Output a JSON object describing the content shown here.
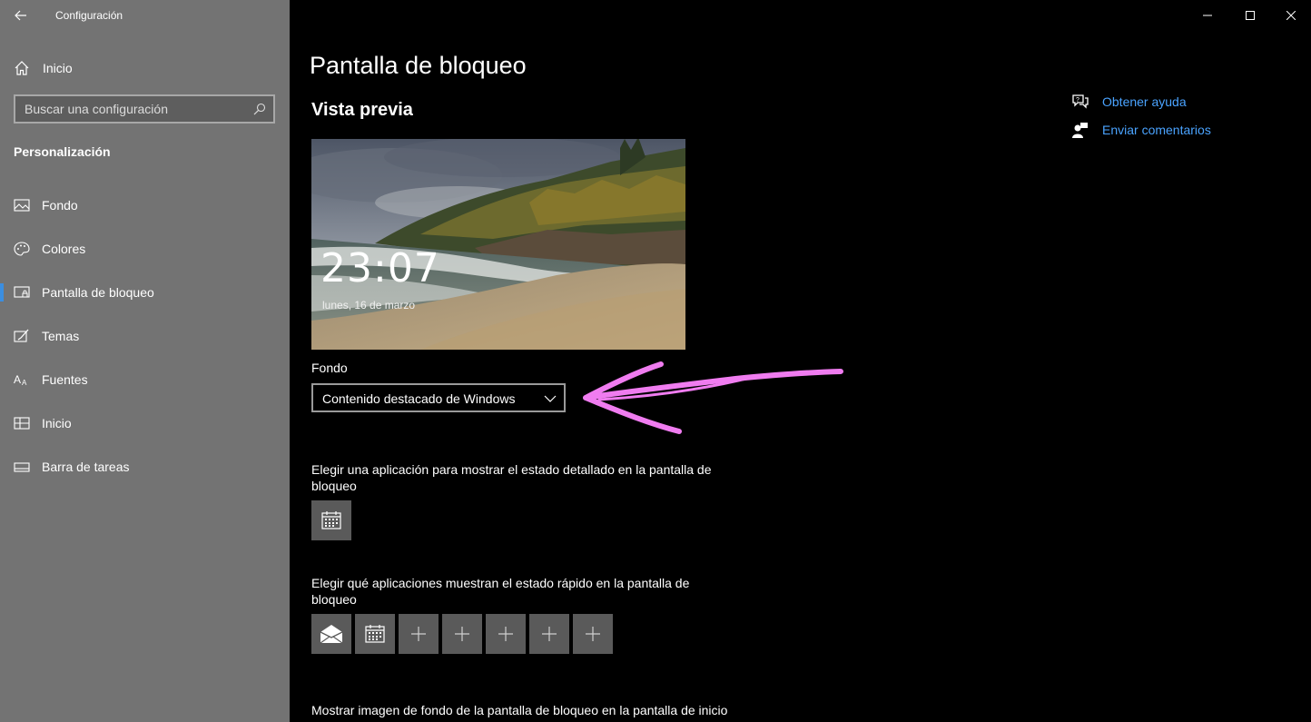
{
  "window": {
    "title": "Configuración",
    "controls": [
      "minimize-icon",
      "maximize-icon",
      "close-icon"
    ]
  },
  "sidebar": {
    "home_label": "Inicio",
    "search_placeholder": "Buscar una configuración",
    "section_title": "Personalización",
    "items": [
      {
        "label": "Fondo",
        "icon": "picture-icon"
      },
      {
        "label": "Colores",
        "icon": "palette-icon"
      },
      {
        "label": "Pantalla de bloqueo",
        "icon": "lock-screen-icon",
        "active": true
      },
      {
        "label": "Temas",
        "icon": "brush-icon"
      },
      {
        "label": "Fuentes",
        "icon": "font-icon"
      },
      {
        "label": "Inicio",
        "icon": "start-icon"
      },
      {
        "label": "Barra de tareas",
        "icon": "taskbar-icon"
      }
    ],
    "accent_color": "#3b8ee0"
  },
  "main": {
    "page_title": "Pantalla de bloqueo",
    "preview_title": "Vista previa",
    "preview": {
      "time": "23:07",
      "date": "lunes, 16 de marzo"
    },
    "background_label": "Fondo",
    "background_value": "Contenido destacado de Windows",
    "detail_label": "Elegir una aplicación para mostrar el estado detallado en la pantalla de bloqueo",
    "detail_app_icon": "calendar-icon",
    "quick_label": "Elegir qué aplicaciones muestran el estado rápido en la pantalla de bloqueo",
    "quick_apps": [
      "mail-icon",
      "calendar-icon",
      "plus-icon",
      "plus-icon",
      "plus-icon",
      "plus-icon",
      "plus-icon"
    ],
    "bottom_label": "Mostrar imagen de fondo de la pantalla de bloqueo en la pantalla de inicio de sesión"
  },
  "help": {
    "get_help": "Obtener ayuda",
    "feedback": "Enviar comentarios",
    "link_color": "#4aa3ff"
  },
  "annotation": {
    "arrow_color": "#f07cf0"
  }
}
